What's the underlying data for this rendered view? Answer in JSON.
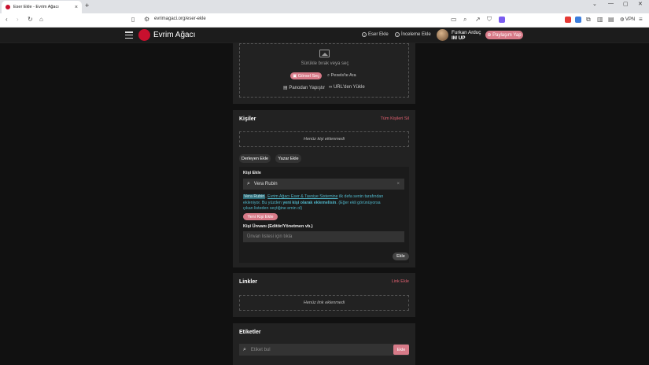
{
  "browser": {
    "tab_title": "Eser Ekle - Evrim Ağacı",
    "tab_close": "×",
    "new_tab": "+",
    "url": "evrimagaci.org/eser-ekle",
    "vpn_label": "VPN"
  },
  "header": {
    "brand": "Evrim Ağacı",
    "nav": [
      {
        "label": "Eser Ekle"
      },
      {
        "label": "İnceleme Ekle"
      }
    ],
    "user_name": "Furkan Arduç",
    "user_badge": "IM UP",
    "share_button": "Paylaşım Yap"
  },
  "upload": {
    "hint": "Sürükle bırak veya seç",
    "select_image": "Görsel Seç",
    "pexels_search": "Pexels'te Ara",
    "paste": "Panodan Yapıştır",
    "from_url": "URL'den Yükle"
  },
  "people": {
    "title": "Kişiler",
    "clear_all": "Tüm Kişileri Sil",
    "empty": "Henüz kişi eklenmedi",
    "add_compiler": "Derleyen Ekle",
    "add_author": "Yazar Ekle",
    "add_person_label": "Kişi Ekle",
    "search_value": "Vera Rubin",
    "clear_x": "×",
    "warn_name": "Vera Rubin",
    "warn_link": "Evrim Ağacı Eser & Tavsiye Sistemine",
    "warn_text_1": ", ",
    "warn_text_2": " ilk defa senin tarafından ekleniyor. Bu yüzden ",
    "warn_bold": "yeni kişi olarak eklemelisin",
    "warn_text_3": ". (Eğer ekli görünüyorsa çıkan listeden seçtiğine emin ol)",
    "new_person_button": "Yeni Kişi Ekle",
    "title_label": "Kişi Ünvanı (Editör/Yönetmen vb.)",
    "title_placeholder": "Ünvan listesi için tıkla",
    "add_button": "Ekle"
  },
  "links": {
    "title": "Linkler",
    "add_link": "Link Ekle",
    "empty": "Henüz link eklenmedi"
  },
  "tags": {
    "title": "Etiketler",
    "placeholder": "Etiket bul",
    "add_button": "Ekle"
  }
}
